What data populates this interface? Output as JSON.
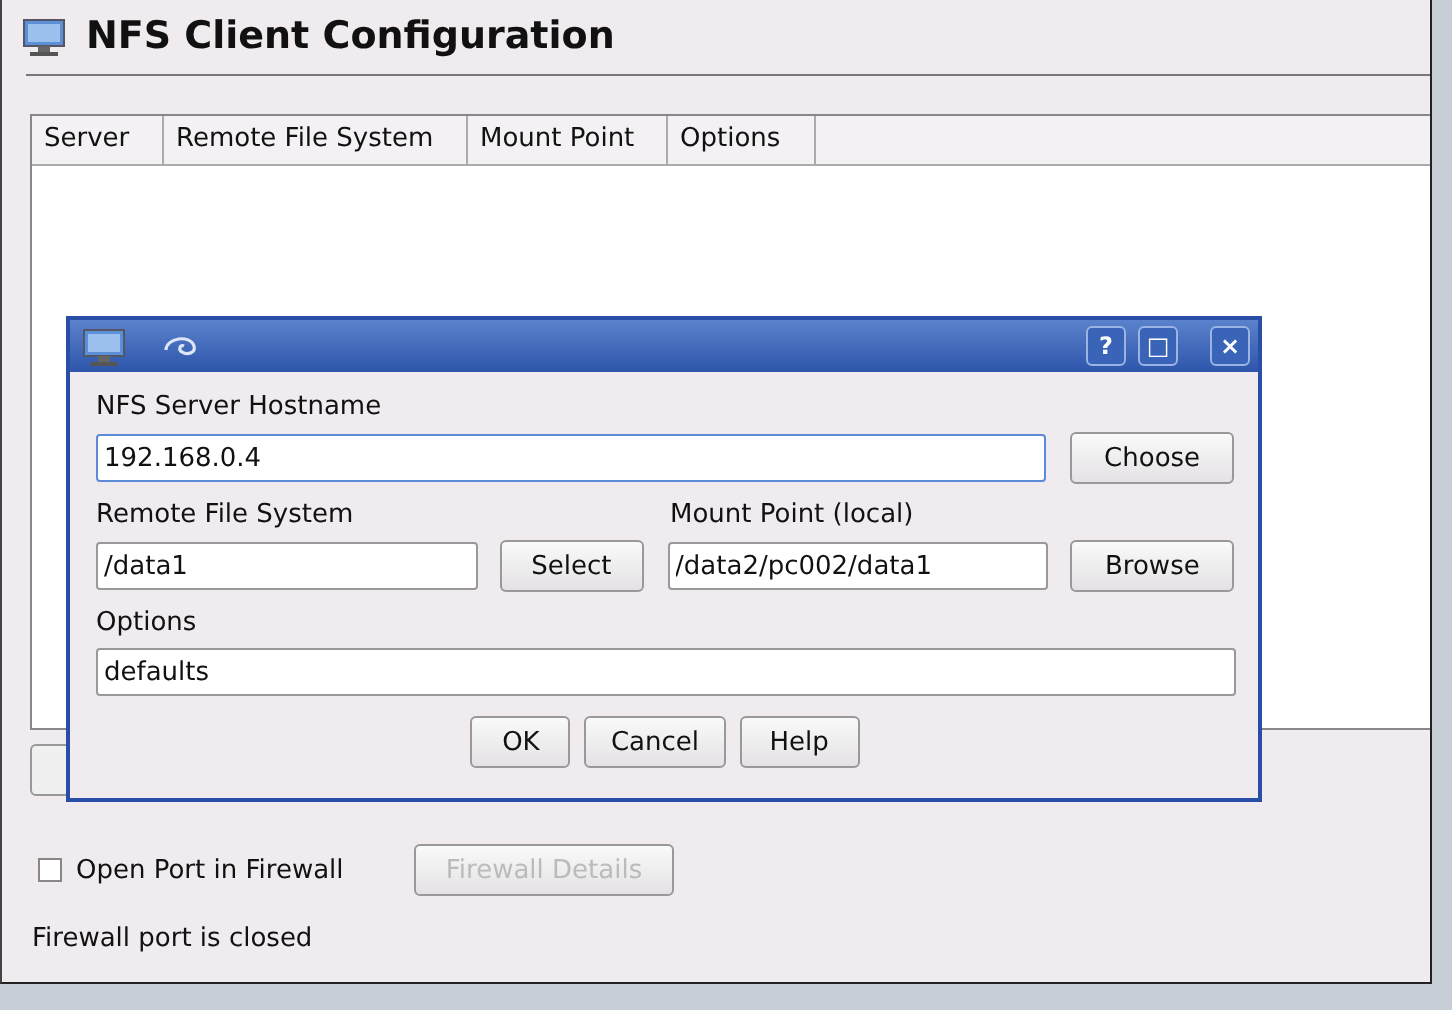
{
  "window": {
    "title": "NFS Client Configuration"
  },
  "table": {
    "columns": [
      "Server",
      "Remote File System",
      "Mount Point",
      "Options"
    ]
  },
  "firewall": {
    "checkbox": {
      "label": "Open Port in Firewall",
      "checked": false
    },
    "details_button": {
      "label": "Firewall Details",
      "disabled": true
    },
    "status": "Firewall port is closed"
  },
  "dialog": {
    "hostname": {
      "label": "NFS Server Hostname",
      "value": "192.168.0.4",
      "button": "Choose"
    },
    "remote": {
      "label": "Remote File System",
      "value": "/data1",
      "button": "Select"
    },
    "mount": {
      "label": "Mount Point (local)",
      "value": "/data2/pc002/data1",
      "button": "Browse"
    },
    "options": {
      "label": "Options",
      "value": "defaults"
    },
    "buttons": [
      "OK",
      "Cancel",
      "Help"
    ],
    "titlebar_buttons": [
      "?",
      "□",
      "×"
    ]
  }
}
